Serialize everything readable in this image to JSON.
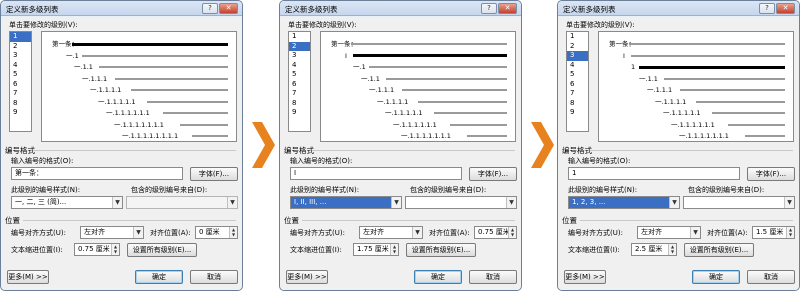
{
  "arrow_color": "#e8821e",
  "dialogs": [
    {
      "title": "定义新多级列表",
      "help": "?",
      "close": "✕",
      "level_prompt": "单击要修改的级别(V):",
      "levels": [
        "1",
        "2",
        "3",
        "4",
        "5",
        "6",
        "7",
        "8",
        "9"
      ],
      "selected_level": 1,
      "preview_labels": [
        "第一条：",
        "一.1",
        "一.1.1",
        "一.1.1.1",
        "一.1.1.1.1",
        "一.1.1.1.1.1",
        "一.1.1.1.1.1.1",
        "一.1.1.1.1.1.1.1",
        "一.1.1.1.1.1.1.1.1"
      ],
      "number_format_section": "编号格式",
      "format_input_label": "输入编号的格式(O):",
      "format_input_value": "第一条：",
      "font_button": "字体(F)...",
      "style_label": "此级别的编号样式(N):",
      "style_value": "一, 二, 三 (简)...",
      "style_selected": false,
      "include_label": "包含的级别编号来自(D):",
      "include_value": "",
      "include_disabled": true,
      "position_section": "位置",
      "align_label": "编号对齐方式(U):",
      "align_value": "左对齐",
      "align_at_label": "对齐位置(A):",
      "align_at_value": "0 厘米",
      "indent_label": "文本缩进位置(I):",
      "indent_value": "0.75 厘米",
      "set_all_button": "设置所有级别(E)...",
      "more_button": "更多(M) >>",
      "ok_button": "确定",
      "cancel_button": "取消"
    },
    {
      "title": "定义新多级列表",
      "help": "?",
      "close": "✕",
      "level_prompt": "单击要修改的级别(V):",
      "levels": [
        "1",
        "2",
        "3",
        "4",
        "5",
        "6",
        "7",
        "8",
        "9"
      ],
      "selected_level": 2,
      "preview_labels": [
        "第一条：",
        "I",
        "一.1",
        "一.1.1",
        "一.1.1.1",
        "一.1.1.1.1",
        "一.1.1.1.1.1",
        "一.1.1.1.1.1.1",
        "一.1.1.1.1.1.1.1"
      ],
      "number_format_section": "编号格式",
      "format_input_label": "输入编号的格式(O):",
      "format_input_value": "I",
      "font_button": "字体(F)...",
      "style_label": "此级别的编号样式(N):",
      "style_value": "I, II, III, ...",
      "style_selected": true,
      "include_label": "包含的级别编号来自(D):",
      "include_value": "",
      "include_disabled": false,
      "position_section": "位置",
      "align_label": "编号对齐方式(U):",
      "align_value": "左对齐",
      "align_at_label": "对齐位置(A):",
      "align_at_value": "0.75 厘米",
      "indent_label": "文本缩进位置(I):",
      "indent_value": "1.75 厘米",
      "set_all_button": "设置所有级别(E)...",
      "more_button": "更多(M) >>",
      "ok_button": "确定",
      "cancel_button": "取消"
    },
    {
      "title": "定义新多级列表",
      "help": "?",
      "close": "✕",
      "level_prompt": "单击要修改的级别(V):",
      "levels": [
        "1",
        "2",
        "3",
        "4",
        "5",
        "6",
        "7",
        "8",
        "9"
      ],
      "selected_level": 3,
      "preview_labels": [
        "第一条：",
        "I",
        "1",
        "一.1.1",
        "一.1.1.1",
        "一.1.1.1.1",
        "一.1.1.1.1.1",
        "一.1.1.1.1.1.1",
        "一.1.1.1.1.1.1.1"
      ],
      "number_format_section": "编号格式",
      "format_input_label": "输入编号的格式(O):",
      "format_input_value": "1",
      "font_button": "字体(F)...",
      "style_label": "此级别的编号样式(N):",
      "style_value": "1, 2, 3, ...",
      "style_selected": true,
      "include_label": "包含的级别编号来自(D):",
      "include_value": "",
      "include_disabled": false,
      "position_section": "位置",
      "align_label": "编号对齐方式(U):",
      "align_value": "左对齐",
      "align_at_label": "对齐位置(A):",
      "align_at_value": "1.5 厘米",
      "indent_label": "文本缩进位置(I):",
      "indent_value": "2.5 厘米",
      "set_all_button": "设置所有级别(E)...",
      "more_button": "更多(M) >>",
      "ok_button": "确定",
      "cancel_button": "取消"
    }
  ]
}
